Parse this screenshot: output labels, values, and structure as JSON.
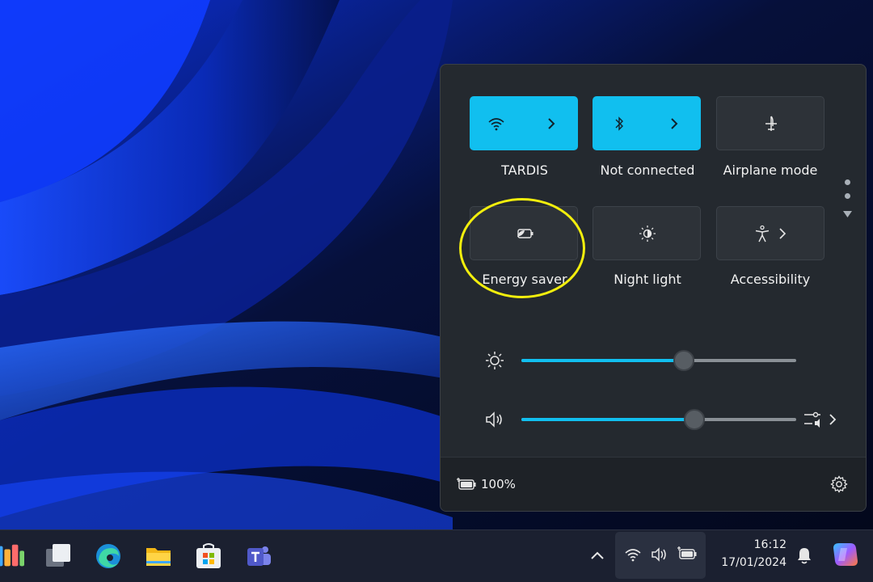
{
  "quick_settings": {
    "tiles": [
      {
        "id": "wifi",
        "label": "TARDIS",
        "icon": "wifi-icon",
        "state": "on",
        "has_chevron": true
      },
      {
        "id": "bluetooth",
        "label": "Not connected",
        "icon": "bluetooth-icon",
        "state": "on",
        "has_chevron": true
      },
      {
        "id": "airplane",
        "label": "Airplane mode",
        "icon": "airplane-icon",
        "state": "off",
        "has_chevron": false
      },
      {
        "id": "energy-saver",
        "label": "Energy saver",
        "icon": "energy-saver-icon",
        "state": "off",
        "has_chevron": false
      },
      {
        "id": "night-light",
        "label": "Night light",
        "icon": "night-light-icon",
        "state": "off",
        "has_chevron": false
      },
      {
        "id": "accessibility",
        "label": "Accessibility",
        "icon": "accessibility-icon",
        "state": "off",
        "has_chevron": true
      }
    ],
    "brightness": {
      "icon": "brightness-icon",
      "level": 0.59
    },
    "volume": {
      "icon": "speaker-icon",
      "level": 0.63,
      "extra_icon": "audio-mixer-icon"
    },
    "battery": {
      "icon": "battery-icon",
      "text": "100%"
    },
    "settings_icon": "gear-icon"
  },
  "taskbar": {
    "apps": [
      "widgets-icon",
      "task-view-icon",
      "edge-icon",
      "file-explorer-icon",
      "store-icon",
      "teams-icon"
    ],
    "tray": {
      "overflow_icon": "chevron-up-icon",
      "icons": [
        "wifi-icon",
        "speaker-icon",
        "battery-icon"
      ]
    },
    "clock": {
      "time": "16:12",
      "date": "17/01/2024"
    },
    "notification_icon": "bell-icon",
    "copilot_icon": "copilot-icon"
  },
  "annotation": {
    "highlight": "energy-saver",
    "color": "#f2ee0d"
  },
  "colors": {
    "accent": "#11bfef",
    "panel": "#24292f",
    "taskbar": "#1b2030"
  }
}
